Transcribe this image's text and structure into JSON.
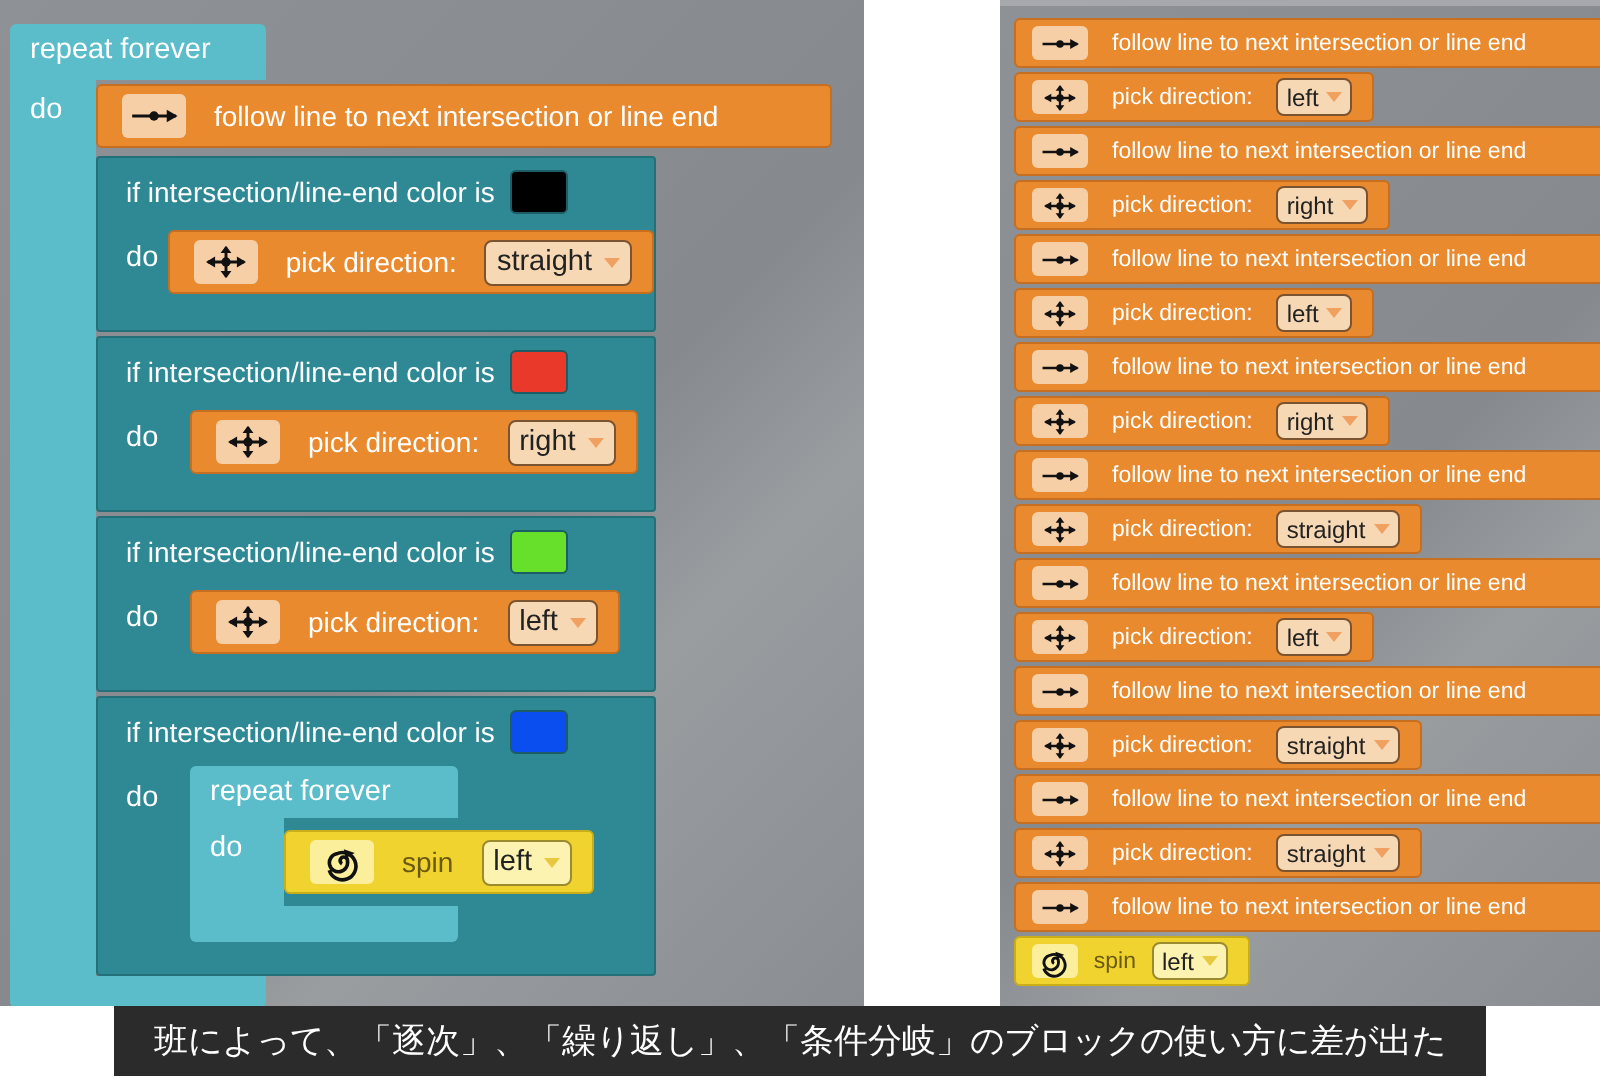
{
  "left_program": {
    "kind": "repeat",
    "label": "repeat forever",
    "do_label": "do",
    "children": [
      {
        "kind": "follow",
        "label": "follow line to next intersection or line end"
      },
      {
        "kind": "if",
        "label": "if intersection/line-end color is",
        "color": "#000000",
        "do_label": "do",
        "children": [
          {
            "kind": "pick",
            "label": "pick direction:",
            "value": "straight"
          }
        ]
      },
      {
        "kind": "if",
        "label": "if intersection/line-end color is",
        "color": "#e8392b",
        "do_label": "do",
        "children": [
          {
            "kind": "pick",
            "label": "pick direction:",
            "value": "right"
          }
        ]
      },
      {
        "kind": "if",
        "label": "if intersection/line-end color is",
        "color": "#66e02a",
        "do_label": "do",
        "children": [
          {
            "kind": "pick",
            "label": "pick direction:",
            "value": "left"
          }
        ]
      },
      {
        "kind": "if",
        "label": "if intersection/line-end color is",
        "color": "#0a4ef0",
        "do_label": "do",
        "children": [
          {
            "kind": "repeat",
            "label": "repeat forever",
            "do_label": "do",
            "children": [
              {
                "kind": "spin",
                "label": "spin",
                "value": "left"
              }
            ]
          }
        ]
      }
    ]
  },
  "right_program": [
    {
      "kind": "follow",
      "label": "follow line to next intersection or line end"
    },
    {
      "kind": "pick",
      "label": "pick direction:",
      "value": "left"
    },
    {
      "kind": "follow",
      "label": "follow line to next intersection or line end"
    },
    {
      "kind": "pick",
      "label": "pick direction:",
      "value": "right"
    },
    {
      "kind": "follow",
      "label": "follow line to next intersection or line end"
    },
    {
      "kind": "pick",
      "label": "pick direction:",
      "value": "left"
    },
    {
      "kind": "follow",
      "label": "follow line to next intersection or line end"
    },
    {
      "kind": "pick",
      "label": "pick direction:",
      "value": "right"
    },
    {
      "kind": "follow",
      "label": "follow line to next intersection or line end"
    },
    {
      "kind": "pick",
      "label": "pick direction:",
      "value": "straight"
    },
    {
      "kind": "follow",
      "label": "follow line to next intersection or line end"
    },
    {
      "kind": "pick",
      "label": "pick direction:",
      "value": "left"
    },
    {
      "kind": "follow",
      "label": "follow line to next intersection or line end"
    },
    {
      "kind": "pick",
      "label": "pick direction:",
      "value": "straight"
    },
    {
      "kind": "follow",
      "label": "follow line to next intersection or line end"
    },
    {
      "kind": "pick",
      "label": "pick direction:",
      "value": "straight"
    },
    {
      "kind": "follow",
      "label": "follow line to next intersection or line end"
    },
    {
      "kind": "spin",
      "label": "spin",
      "value": "left"
    }
  ],
  "caption": "班によって、「逐次」、「繰り返し」、「条件分岐」のブロックの使い方に差が出た"
}
